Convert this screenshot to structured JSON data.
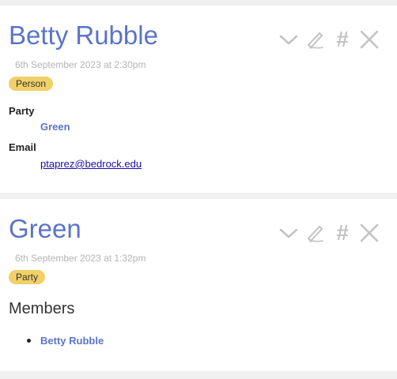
{
  "cards": [
    {
      "title": "Betty Rubble",
      "date": "6th September 2023 at 2:30pm",
      "tag": "Person",
      "fields": {
        "party_label": "Party",
        "party_value": "Green",
        "email_label": "Email",
        "email_value": "ptaprez@bedrock.edu"
      },
      "toolbar": {
        "expand_icon": "chevron-down-icon",
        "edit_icon": "pencil-icon",
        "hash_label": "#",
        "close_icon": "close-icon"
      }
    },
    {
      "title": "Green",
      "date": "6th September 2023 at 1:32pm",
      "tag": "Party",
      "section_heading": "Members",
      "members": [
        "Betty Rubble"
      ],
      "toolbar": {
        "expand_icon": "chevron-down-icon",
        "edit_icon": "pencil-icon",
        "hash_label": "#",
        "close_icon": "close-icon"
      }
    }
  ],
  "colors": {
    "accent": "#5b74c9",
    "tag_bg": "#f1d067",
    "muted": "#b4b4b4",
    "icon": "#c3c3c3",
    "page_bg": "#f0f0f0"
  }
}
